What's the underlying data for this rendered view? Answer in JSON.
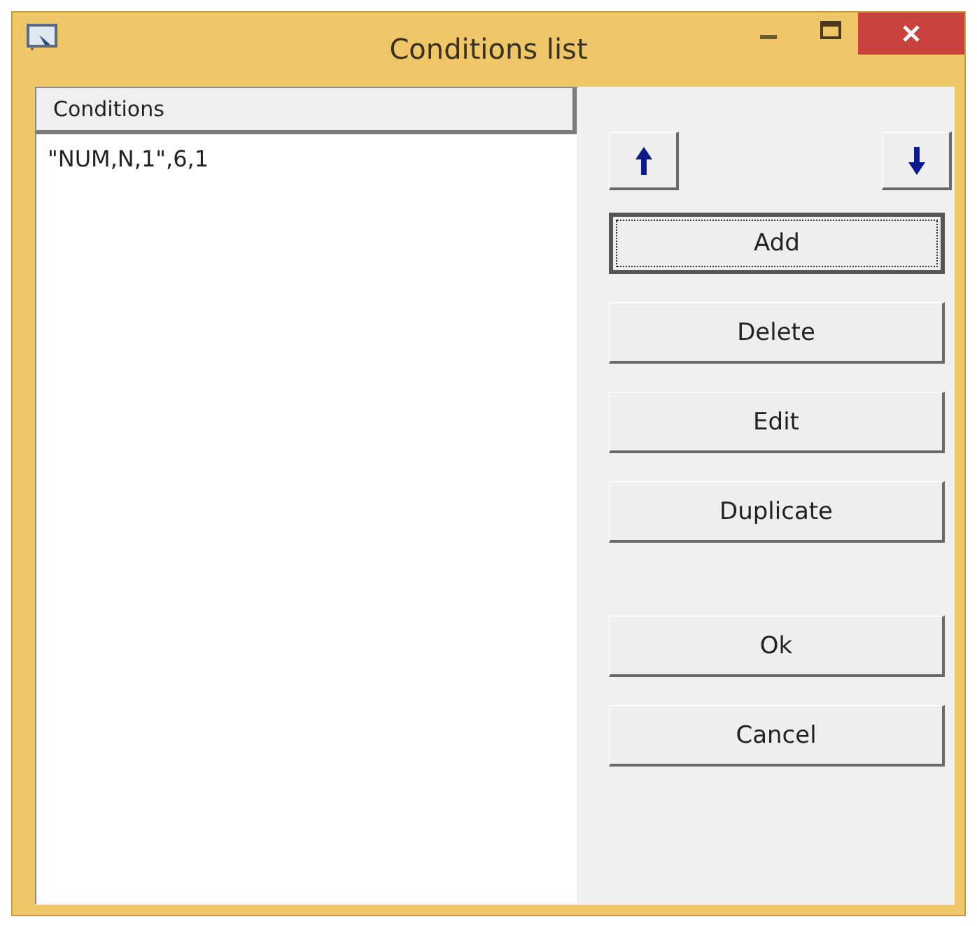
{
  "window": {
    "title": "Conditions list"
  },
  "list": {
    "column": "Conditions",
    "rows": [
      {
        "text": "\"NUM,N,1\",6,1",
        "selected": false
      }
    ]
  },
  "move_buttons": [
    {
      "kind": "up"
    },
    {
      "kind": "down"
    }
  ],
  "edit_buttons": [
    {
      "label": "Add",
      "focused": true
    },
    {
      "label": "Delete",
      "focused": false
    },
    {
      "label": "Edit",
      "focused": false
    },
    {
      "label": "Duplicate",
      "focused": false
    }
  ],
  "dialog_buttons": [
    {
      "label": "Ok",
      "focused": false
    },
    {
      "label": "Cancel",
      "focused": false
    }
  ]
}
